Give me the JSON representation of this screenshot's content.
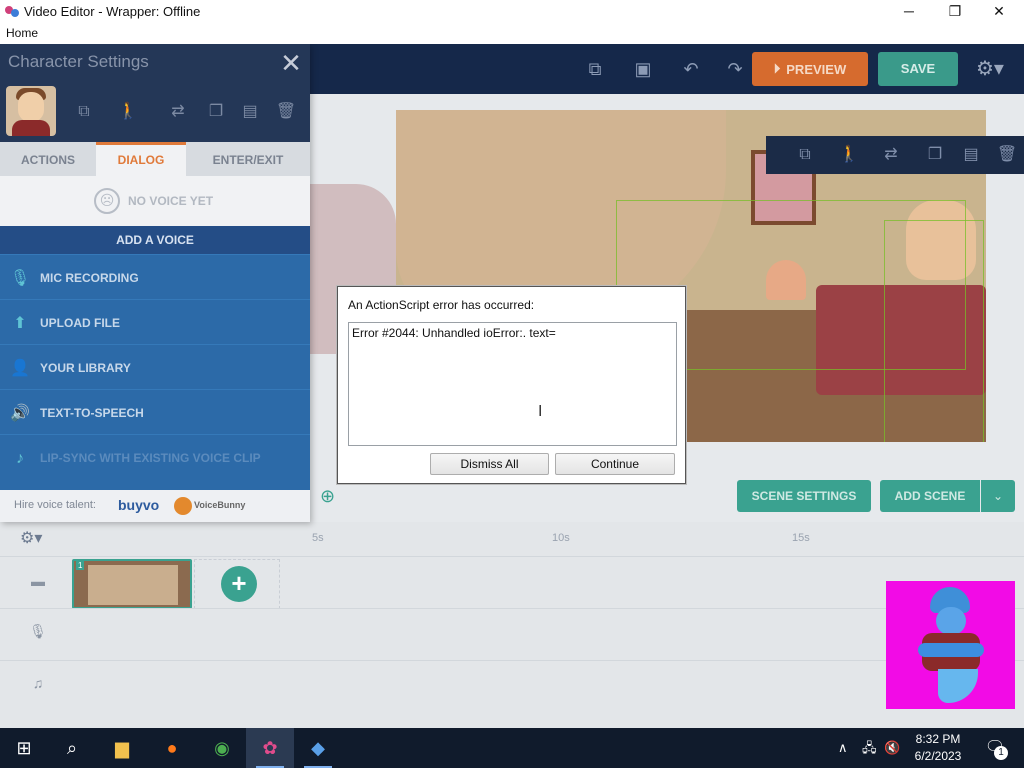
{
  "window": {
    "title": "Video Editor - Wrapper: Offline",
    "menu": [
      "Home"
    ],
    "controls": {
      "minimize": "─",
      "maximize": "❐",
      "close": "✕"
    }
  },
  "editor_toolbar": {
    "preview_label": "PREVIEW",
    "save_label": "SAVE",
    "icons": [
      "copy-icon",
      "paste-icon",
      "undo-icon",
      "redo-icon",
      "gear-icon"
    ]
  },
  "character_panel": {
    "title": "Character Settings",
    "close": "✕",
    "tabs": [
      {
        "label": "ACTIONS",
        "active": false
      },
      {
        "label": "DIALOG",
        "active": true
      },
      {
        "label": "ENTER/EXIT",
        "active": false
      }
    ],
    "no_voice": "NO VOICE YET",
    "add_voice": "ADD A VOICE",
    "voice_options": [
      {
        "label": "MIC RECORDING",
        "icon": "mic-icon",
        "glyph": "🎙"
      },
      {
        "label": "UPLOAD FILE",
        "icon": "upload-icon",
        "glyph": "⬆"
      },
      {
        "label": "YOUR LIBRARY",
        "icon": "library-icon",
        "glyph": "👤"
      },
      {
        "label": "TEXT-TO-SPEECH",
        "icon": "text-to-speech-icon",
        "glyph": "🔊"
      },
      {
        "label": "LIP-SYNC WITH EXISTING VOICE CLIP",
        "icon": "lipsync-icon",
        "glyph": "♪",
        "disabled": true
      }
    ],
    "hire_label": "Hire voice talent:",
    "buyvo": "buyvo",
    "voicebunny": "VoiceBunny"
  },
  "scene_buttons": {
    "scene_settings": "SCENE SETTINGS",
    "add_scene": "ADD SCENE",
    "dropdown": "⌄"
  },
  "timeline": {
    "ticks": [
      "5s",
      "10s",
      "15s"
    ],
    "scene_number": "1",
    "track_icons": [
      "video-track-icon",
      "voice-track-icon",
      "music-track-icon"
    ]
  },
  "dialog": {
    "message": "An ActionScript error has occurred:",
    "error_text": "Error #2044: Unhandled ioError:. text=",
    "dismiss_all": "Dismiss All",
    "continue": "Continue"
  },
  "taskbar": {
    "time": "8:32 PM",
    "date": "6/2/2023",
    "notification_count": "1",
    "apps": [
      "windows-start-icon",
      "search-icon",
      "file-explorer-icon",
      "firefox-icon",
      "chrome-icon",
      "wrapper-app-icon",
      "wrapper-offline-icon"
    ]
  },
  "colors": {
    "topbar": "#15284a",
    "preview": "#d66b2e",
    "save": "#3a9a8a",
    "voice_panel": "#2c6aa8",
    "accent_tab": "#e07a3a",
    "genie_bg": "#f20be6"
  }
}
